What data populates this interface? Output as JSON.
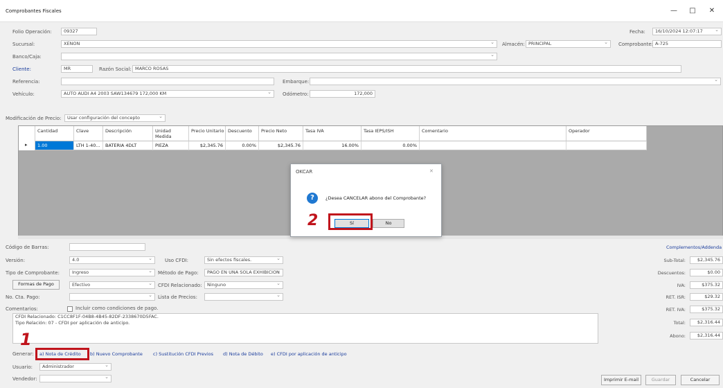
{
  "window": {
    "title": "Comprobantes Fiscales",
    "min": "—",
    "max": "□",
    "close": "✕"
  },
  "header": {
    "folio_label": "Folio Operación:",
    "folio": "09327",
    "sucursal_label": "Sucursal:",
    "sucursal": "XENON",
    "banco_label": "Banco/Caja:",
    "banco": "",
    "cliente_label": "Cliente:",
    "cliente": "MR",
    "razon_label": "Razón Social:",
    "razon": "MARCO ROSAS",
    "ref_label": "Referencia:",
    "ref": "",
    "vehiculo_label": "Vehículo:",
    "vehiculo": "AUTO AUDI A4 2003 SAW134679 172,000 KM",
    "embarque_label": "Embarque:",
    "embarque": "",
    "odometro_label": "Odómetro:",
    "odometro": "172,000",
    "almacen_label": "Almacén:",
    "almacen": "PRINCIPAL",
    "fecha_label": "Fecha:",
    "fecha": "16/10/2024 12:07:17",
    "comprobante_label": "Comprobante:",
    "comprobante": "A-725"
  },
  "mod": {
    "label": "Modificación de Precio:",
    "value": "Usar configuración del concepto"
  },
  "grid": {
    "columns": [
      "Cantidad",
      "Clave",
      "Descripción",
      "Unidad Medida",
      "Precio Unitario",
      "Descuento",
      "Precio Neto",
      "Tasa IVA",
      "Tasa IEPS/ISH",
      "Comentario",
      "Operador"
    ],
    "row": [
      "1.00",
      "LTH 1-40...",
      "BATERIA 4DLT",
      "PIEZA",
      "$2,345.76",
      "0.00%",
      "$2,345.76",
      "16.00%",
      "0.00%",
      "",
      ""
    ],
    "row_marker": "▸"
  },
  "dialog": {
    "title": "OKCAR",
    "close": "✕",
    "message": "¿Desea CANCELAR abono del Comprobante?",
    "yes": "Sí",
    "no": "No",
    "icon": "?"
  },
  "lower": {
    "barras_label": "Código de Barras:",
    "barras": "",
    "version_label": "Versión:",
    "version": "4.0",
    "tipo_label": "Tipo de Comprobante:",
    "tipo": "Ingreso",
    "formas_btn": "Formas de Pago",
    "formas": "Efectivo",
    "ctapago_label": "No. Cta. Pago:",
    "ctapago": "",
    "coment_label": "Comentarios:",
    "incluir": "Incluir como condiciones de pago.",
    "comment_lines": [
      "CFDI Relacionado: C1CC8F1F-04B8-4B45-82DF-2338670D5FAC.",
      "Tipo Relación: 07 - CFDI por aplicación de anticipo."
    ],
    "uso_label": "Uso CFDI:",
    "uso": "Sin efectos fiscales.",
    "metodo_label": "Método de Pago:",
    "metodo": "PAGO EN UNA SOLA EXHIBICION",
    "cfdirel_label": "CFDI Relacionado:",
    "cfdirel": "Ninguno",
    "lista_label": "Lista de Precios:",
    "lista": ""
  },
  "totals": {
    "complementos": "Complementos/Addenda",
    "subtotal_label": "Sub-Total:",
    "subtotal": "$2,345.76",
    "desc_label": "Descuentos:",
    "desc": "$0.00",
    "iva_label": "IVA:",
    "iva": "$375.32",
    "retisr_label": "RET. ISR:",
    "retisr": "$29.32",
    "retiva_label": "RET. IVA:",
    "retiva": "$375.32",
    "total_label": "Total:",
    "total": "$2,316.44",
    "abono_label": "Abono:",
    "abono": "$2,316.44"
  },
  "generar": {
    "label": "Generar:",
    "a": "a) Nota de Crédito",
    "b": "b) Nuevo Comprobante",
    "c": "c) Sustitución CFDI Previos",
    "d": "d) Nota de Débito",
    "e": "e) CFDI por aplicación de anticipo"
  },
  "bottom": {
    "usuario_label": "Usuario:",
    "usuario": "Administrador",
    "vendedor_label": "Vendedor:",
    "vendedor": "",
    "imprimir": "Imprimir E-mail",
    "guardar": "Guardar",
    "cancelar": "Cancelar"
  },
  "steps": {
    "one": "1",
    "two": "2"
  },
  "colors": {
    "highlight": "#c0141c",
    "info": "#1f78d1"
  }
}
